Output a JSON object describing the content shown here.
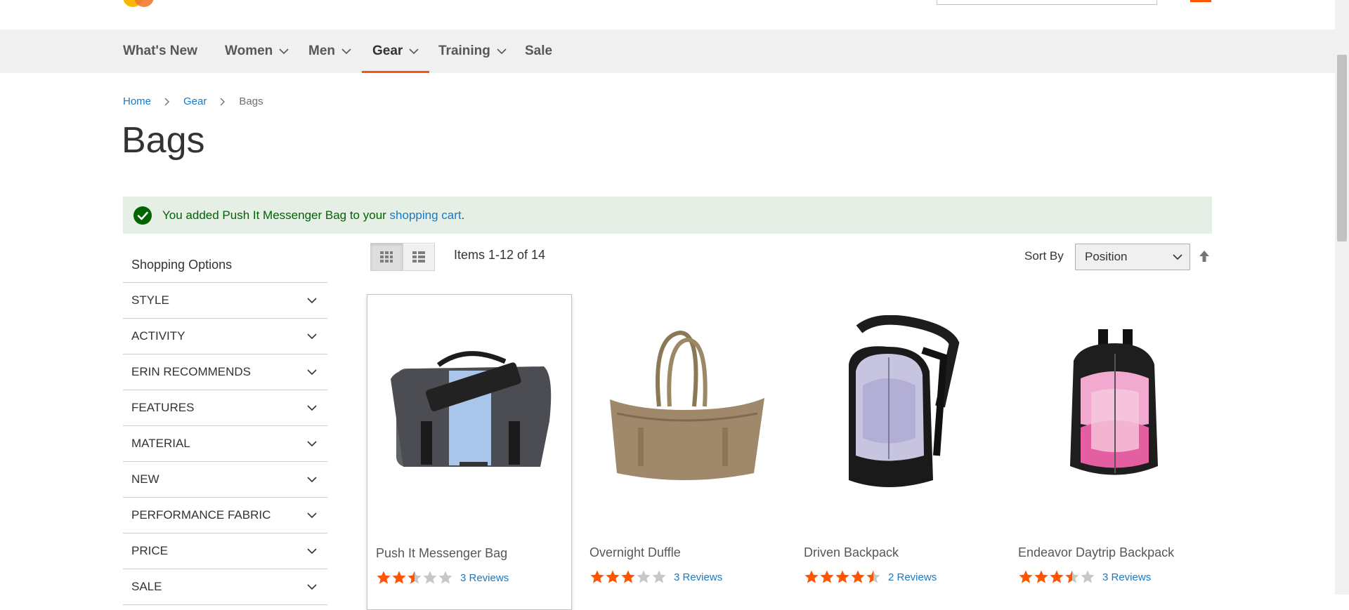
{
  "nav": {
    "items": [
      {
        "label": "What's New",
        "has_menu": false
      },
      {
        "label": "Women",
        "has_menu": true
      },
      {
        "label": "Men",
        "has_menu": true
      },
      {
        "label": "Gear",
        "has_menu": true,
        "active": true
      },
      {
        "label": "Training",
        "has_menu": true
      },
      {
        "label": "Sale",
        "has_menu": false
      }
    ]
  },
  "breadcrumb": {
    "home": "Home",
    "gear": "Gear",
    "current": "Bags"
  },
  "page": {
    "title": "Bags"
  },
  "message": {
    "text_before": "You added Push It Messenger Bag to your ",
    "link": "shopping cart",
    "text_after": ".",
    "icon": "success-check-icon"
  },
  "sidebar": {
    "title": "Shopping Options",
    "filters": [
      "STYLE",
      "ACTIVITY",
      "ERIN RECOMMENDS",
      "FEATURES",
      "MATERIAL",
      "NEW",
      "PERFORMANCE FABRIC",
      "PRICE",
      "SALE"
    ]
  },
  "toolbar": {
    "items_count": "Items 1-12 of 14",
    "sort_label": "Sort By",
    "sort_value": "Position",
    "grid_icon": "grid-view-icon",
    "list_icon": "list-view-icon",
    "sort_direction_icon": "arrow-up-icon"
  },
  "products": [
    {
      "name": "Push It Messenger Bag",
      "rating": 2.5,
      "reviews": "3 Reviews"
    },
    {
      "name": "Overnight Duffle",
      "rating": 3,
      "reviews": "3 Reviews"
    },
    {
      "name": "Driven Backpack",
      "rating": 4.5,
      "reviews": "2 Reviews"
    },
    {
      "name": "Endeavor Daytrip Backpack",
      "rating": 3.5,
      "reviews": "3 Reviews"
    }
  ],
  "colors": {
    "accent": "#ff5501",
    "link": "#1979c3",
    "success_bg": "#e5efe5",
    "success_text": "#006400"
  }
}
